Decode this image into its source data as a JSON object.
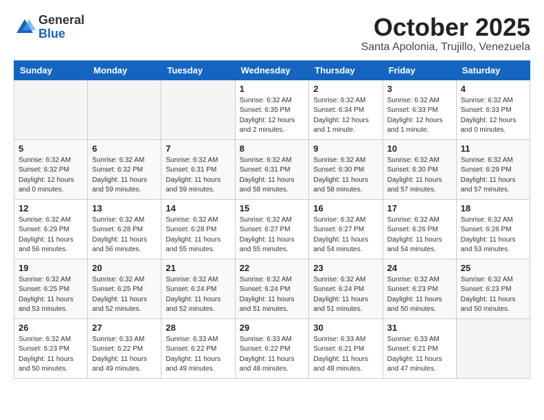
{
  "header": {
    "logo_general": "General",
    "logo_blue": "Blue",
    "month_title": "October 2025",
    "subtitle": "Santa Apolonia, Trujillo, Venezuela"
  },
  "weekdays": [
    "Sunday",
    "Monday",
    "Tuesday",
    "Wednesday",
    "Thursday",
    "Friday",
    "Saturday"
  ],
  "weeks": [
    [
      {
        "day": "",
        "info": ""
      },
      {
        "day": "",
        "info": ""
      },
      {
        "day": "",
        "info": ""
      },
      {
        "day": "1",
        "info": "Sunrise: 6:32 AM\nSunset: 6:35 PM\nDaylight: 12 hours\nand 2 minutes."
      },
      {
        "day": "2",
        "info": "Sunrise: 6:32 AM\nSunset: 6:34 PM\nDaylight: 12 hours\nand 1 minute."
      },
      {
        "day": "3",
        "info": "Sunrise: 6:32 AM\nSunset: 6:33 PM\nDaylight: 12 hours\nand 1 minute."
      },
      {
        "day": "4",
        "info": "Sunrise: 6:32 AM\nSunset: 6:33 PM\nDaylight: 12 hours\nand 0 minutes."
      }
    ],
    [
      {
        "day": "5",
        "info": "Sunrise: 6:32 AM\nSunset: 6:32 PM\nDaylight: 12 hours\nand 0 minutes."
      },
      {
        "day": "6",
        "info": "Sunrise: 6:32 AM\nSunset: 6:32 PM\nDaylight: 11 hours\nand 59 minutes."
      },
      {
        "day": "7",
        "info": "Sunrise: 6:32 AM\nSunset: 6:31 PM\nDaylight: 11 hours\nand 59 minutes."
      },
      {
        "day": "8",
        "info": "Sunrise: 6:32 AM\nSunset: 6:31 PM\nDaylight: 11 hours\nand 58 minutes."
      },
      {
        "day": "9",
        "info": "Sunrise: 6:32 AM\nSunset: 6:30 PM\nDaylight: 11 hours\nand 58 minutes."
      },
      {
        "day": "10",
        "info": "Sunrise: 6:32 AM\nSunset: 6:30 PM\nDaylight: 11 hours\nand 57 minutes."
      },
      {
        "day": "11",
        "info": "Sunrise: 6:32 AM\nSunset: 6:29 PM\nDaylight: 11 hours\nand 57 minutes."
      }
    ],
    [
      {
        "day": "12",
        "info": "Sunrise: 6:32 AM\nSunset: 6:29 PM\nDaylight: 11 hours\nand 56 minutes."
      },
      {
        "day": "13",
        "info": "Sunrise: 6:32 AM\nSunset: 6:28 PM\nDaylight: 11 hours\nand 56 minutes."
      },
      {
        "day": "14",
        "info": "Sunrise: 6:32 AM\nSunset: 6:28 PM\nDaylight: 11 hours\nand 55 minutes."
      },
      {
        "day": "15",
        "info": "Sunrise: 6:32 AM\nSunset: 6:27 PM\nDaylight: 11 hours\nand 55 minutes."
      },
      {
        "day": "16",
        "info": "Sunrise: 6:32 AM\nSunset: 6:27 PM\nDaylight: 11 hours\nand 54 minutes."
      },
      {
        "day": "17",
        "info": "Sunrise: 6:32 AM\nSunset: 6:26 PM\nDaylight: 11 hours\nand 54 minutes."
      },
      {
        "day": "18",
        "info": "Sunrise: 6:32 AM\nSunset: 6:26 PM\nDaylight: 11 hours\nand 53 minutes."
      }
    ],
    [
      {
        "day": "19",
        "info": "Sunrise: 6:32 AM\nSunset: 6:25 PM\nDaylight: 11 hours\nand 53 minutes."
      },
      {
        "day": "20",
        "info": "Sunrise: 6:32 AM\nSunset: 6:25 PM\nDaylight: 11 hours\nand 52 minutes."
      },
      {
        "day": "21",
        "info": "Sunrise: 6:32 AM\nSunset: 6:24 PM\nDaylight: 11 hours\nand 52 minutes."
      },
      {
        "day": "22",
        "info": "Sunrise: 6:32 AM\nSunset: 6:24 PM\nDaylight: 11 hours\nand 51 minutes."
      },
      {
        "day": "23",
        "info": "Sunrise: 6:32 AM\nSunset: 6:24 PM\nDaylight: 11 hours\nand 51 minutes."
      },
      {
        "day": "24",
        "info": "Sunrise: 6:32 AM\nSunset: 6:23 PM\nDaylight: 11 hours\nand 50 minutes."
      },
      {
        "day": "25",
        "info": "Sunrise: 6:32 AM\nSunset: 6:23 PM\nDaylight: 11 hours\nand 50 minutes."
      }
    ],
    [
      {
        "day": "26",
        "info": "Sunrise: 6:32 AM\nSunset: 6:23 PM\nDaylight: 11 hours\nand 50 minutes."
      },
      {
        "day": "27",
        "info": "Sunrise: 6:33 AM\nSunset: 6:22 PM\nDaylight: 11 hours\nand 49 minutes."
      },
      {
        "day": "28",
        "info": "Sunrise: 6:33 AM\nSunset: 6:22 PM\nDaylight: 11 hours\nand 49 minutes."
      },
      {
        "day": "29",
        "info": "Sunrise: 6:33 AM\nSunset: 6:22 PM\nDaylight: 11 hours\nand 48 minutes."
      },
      {
        "day": "30",
        "info": "Sunrise: 6:33 AM\nSunset: 6:21 PM\nDaylight: 11 hours\nand 48 minutes."
      },
      {
        "day": "31",
        "info": "Sunrise: 6:33 AM\nSunset: 6:21 PM\nDaylight: 11 hours\nand 47 minutes."
      },
      {
        "day": "",
        "info": ""
      }
    ]
  ]
}
